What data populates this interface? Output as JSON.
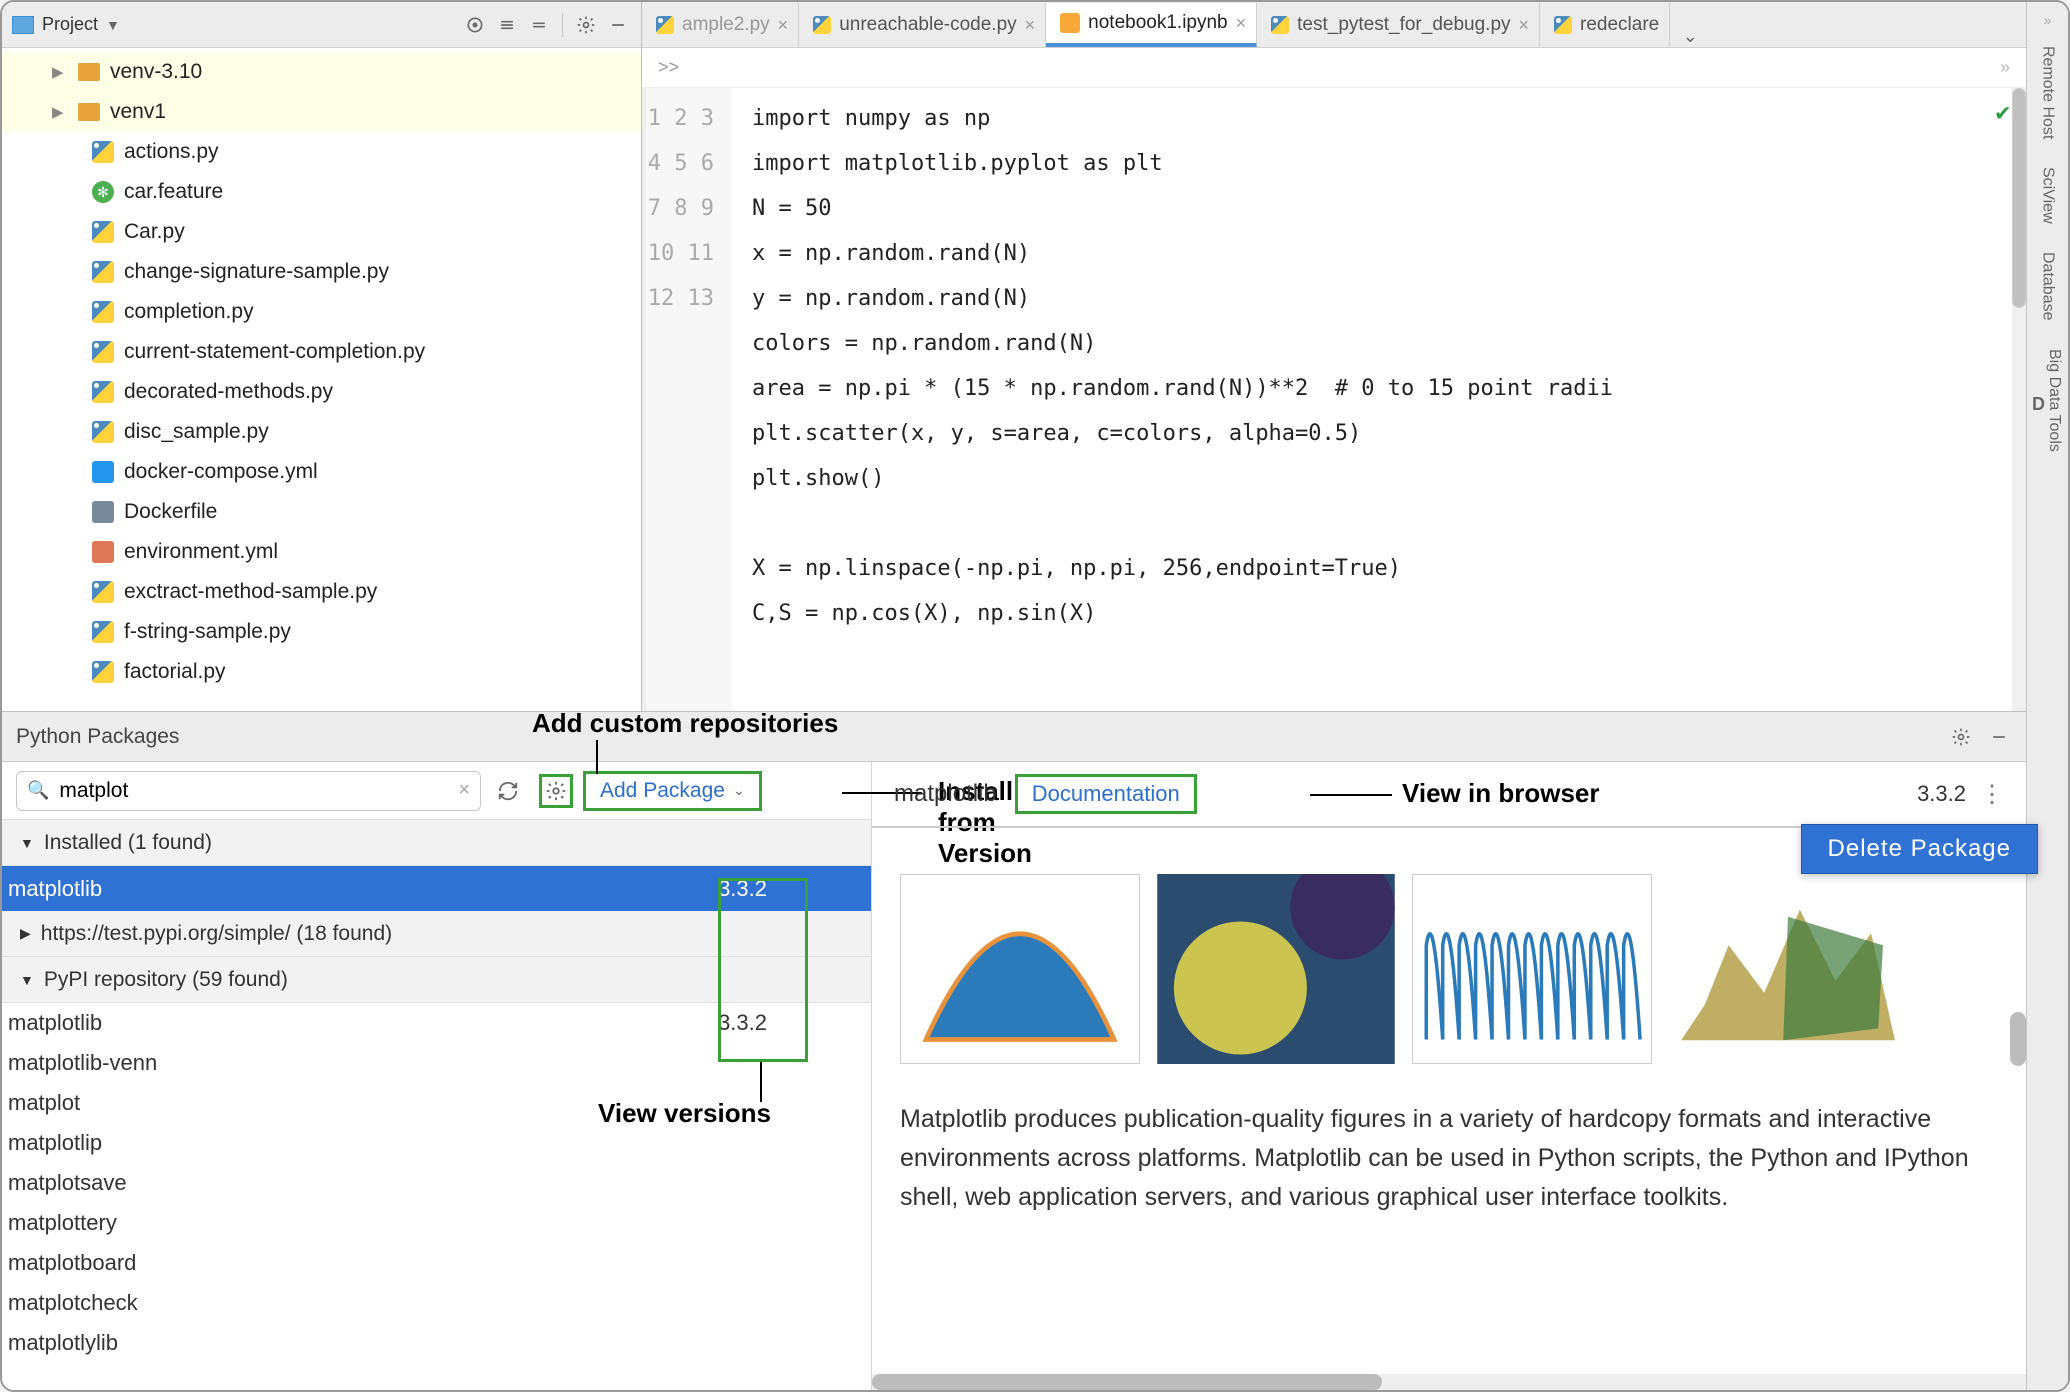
{
  "project_panel": {
    "title": "Project",
    "folders": [
      {
        "name": "venv-3.10"
      },
      {
        "name": "venv1"
      }
    ],
    "files": [
      {
        "name": "actions.py",
        "icon": "py"
      },
      {
        "name": "car.feature",
        "icon": "feature"
      },
      {
        "name": "Car.py",
        "icon": "py"
      },
      {
        "name": "change-signature-sample.py",
        "icon": "py"
      },
      {
        "name": "completion.py",
        "icon": "py"
      },
      {
        "name": "current-statement-completion.py",
        "icon": "py"
      },
      {
        "name": "decorated-methods.py",
        "icon": "py"
      },
      {
        "name": "disc_sample.py",
        "icon": "py"
      },
      {
        "name": "docker-compose.yml",
        "icon": "docker"
      },
      {
        "name": "Dockerfile",
        "icon": "dockerfile"
      },
      {
        "name": "environment.yml",
        "icon": "yml"
      },
      {
        "name": "exctract-method-sample.py",
        "icon": "py"
      },
      {
        "name": "f-string-sample.py",
        "icon": "py"
      },
      {
        "name": "factorial.py",
        "icon": "py"
      }
    ]
  },
  "tabs": [
    {
      "label": "ample2.py",
      "icon": "py",
      "truncated": true
    },
    {
      "label": "unreachable-code.py",
      "icon": "py"
    },
    {
      "label": "notebook1.ipynb",
      "icon": "ipynb",
      "active": true
    },
    {
      "label": "test_pytest_for_debug.py",
      "icon": "py"
    },
    {
      "label": "redeclare",
      "icon": "py",
      "truncated_right": true
    }
  ],
  "breadcrumb": ">>",
  "code_lines": [
    "import numpy as np",
    "import matplotlib.pyplot as plt",
    "N = 50",
    "x = np.random.rand(N)",
    "y = np.random.rand(N)",
    "colors = np.random.rand(N)",
    "area = np.pi * (15 * np.random.rand(N))**2  # 0 to 15 point radii",
    "plt.scatter(x, y, s=area, c=colors, alpha=0.5)",
    "plt.show()",
    "",
    "X = np.linspace(-np.pi, np.pi, 256,endpoint=True)",
    "C,S = np.cos(X), np.sin(X)",
    ""
  ],
  "highlighted_line_index": 4,
  "packages_panel": {
    "title": "Python Packages",
    "search_value": "matplot",
    "add_package_label": "Add Package",
    "sections": {
      "installed": {
        "label": "Installed (1 found)",
        "items": [
          {
            "name": "matplotlib",
            "version": "3.3.2",
            "selected": true
          }
        ]
      },
      "test_pypi": {
        "label": "https://test.pypi.org/simple/ (18 found)",
        "collapsed": true
      },
      "pypi": {
        "label": "PyPI repository (59 found)",
        "items": [
          {
            "name": "matplotlib",
            "version": "3.3.2"
          },
          {
            "name": "matplotlib-venn"
          },
          {
            "name": "matplot"
          },
          {
            "name": "matplotlip"
          },
          {
            "name": "matplotsave"
          },
          {
            "name": "matplottery"
          },
          {
            "name": "matplotboard"
          },
          {
            "name": "matplotcheck"
          },
          {
            "name": "matplotlylib"
          }
        ]
      }
    },
    "detail": {
      "name": "matplotlib",
      "doc_link": "Documentation",
      "version": "3.3.2",
      "delete_label": "Delete Package",
      "description": "Matplotlib produces publication-quality figures in a variety of hardcopy formats and interactive environments across platforms. Matplotlib can be used in Python scripts, the Python and IPython shell, web application servers, and various graphical user interface toolkits."
    }
  },
  "annotations": {
    "add_repos": "Add custom repositories",
    "install_vcs": "Install from Version Control or local disc",
    "view_versions": "View versions",
    "view_browser": "View in browser"
  },
  "rail": [
    "Remote Host",
    "SciView",
    "Database",
    "Big Data Tools"
  ],
  "rail_d_prefix": "D"
}
